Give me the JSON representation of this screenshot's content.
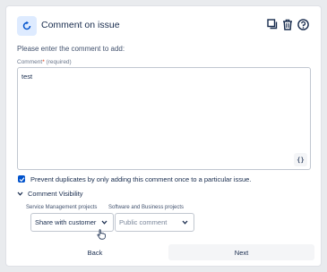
{
  "header": {
    "title": "Comment on issue",
    "icon": "rotate-arrow-icon",
    "accent": "#0052cc",
    "actions": [
      "copy-icon",
      "trash-icon",
      "help-icon"
    ]
  },
  "form": {
    "prompt": "Please enter the comment to add:",
    "comment_label": "Comment",
    "required_marker": "*",
    "required_text": "(required)",
    "comment_value": "test",
    "code_button": "{}",
    "prevent_duplicates_checked": true,
    "prevent_duplicates_label": "Prevent duplicates by only adding this comment once to a particular issue.",
    "visibility_label": "Comment Visibility",
    "service_label": "Service Management projects",
    "service_value": "Share with customer",
    "software_label": "Software and Business projects",
    "software_placeholder": "Public comment"
  },
  "footer": {
    "back_label": "Back",
    "next_label": "Next"
  }
}
